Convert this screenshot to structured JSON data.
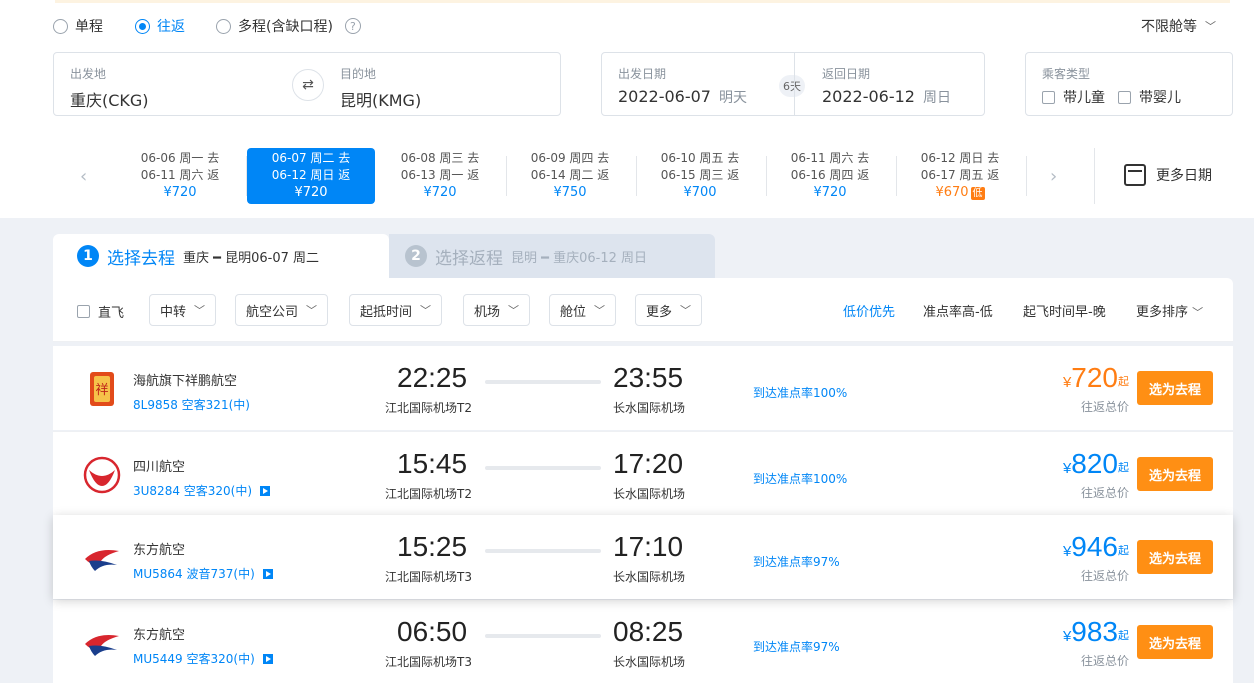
{
  "trip_types": [
    "单程",
    "往返",
    "多程(含缺口程)"
  ],
  "help_icon": "?",
  "cabin_select": "不限舱等",
  "search": {
    "from_label": "出发地",
    "from_value": "重庆(CKG)",
    "to_label": "目的地",
    "to_value": "昆明(KMG)",
    "depart_label": "出发日期",
    "depart_value": "2022-06-07",
    "depart_weekday": "明天",
    "return_label": "返回日期",
    "return_value": "2022-06-12",
    "return_weekday": "周日",
    "days": "6天",
    "pax_label": "乘客类型",
    "child": "带儿童",
    "infant": "带婴儿"
  },
  "date_options": [
    {
      "go": "06-06  周一 去",
      "back": "06-11  周六 返",
      "price": "¥720"
    },
    {
      "go": "06-07  周二 去",
      "back": "06-12  周日 返",
      "price": "¥720",
      "selected": true
    },
    {
      "go": "06-08  周三 去",
      "back": "06-13  周一 返",
      "price": "¥720"
    },
    {
      "go": "06-09  周四 去",
      "back": "06-14  周二 返",
      "price": "¥750"
    },
    {
      "go": "06-10  周五 去",
      "back": "06-15  周三 返",
      "price": "¥700"
    },
    {
      "go": "06-11  周六 去",
      "back": "06-16  周四 返",
      "price": "¥720"
    },
    {
      "go": "06-12  周日 去",
      "back": "06-17  周五 返",
      "price": "¥670",
      "low": "低"
    }
  ],
  "more_dates": "更多日期",
  "tabs": {
    "step1_num": "1",
    "step1_title": "选择去程",
    "step1_sub": "重庆 ━ 昆明06-07 周二",
    "step2_num": "2",
    "step2_title": "选择返程",
    "step2_sub": "昆明 ━ 重庆06-12 周日"
  },
  "filters": {
    "direct": "直飞",
    "items": [
      "中转",
      "航空公司",
      "起抵时间",
      "机场",
      "舱位",
      "更多"
    ]
  },
  "sorts": [
    "低价优先",
    "准点率高-低",
    "起飞时间早-晚",
    "更多排序"
  ],
  "flights": [
    {
      "airline": "海航旗下祥鹏航空",
      "flight": "8L9858 空客321(中)",
      "dep": "22:25",
      "dep_apt": "江北国际机场T2",
      "arr": "23:55",
      "arr_apt": "长水国际机场",
      "ontime": "到达准点率100%",
      "price": "720",
      "cur": "¥",
      "qi": "起",
      "total": "往返总价",
      "btn": "选为去程"
    },
    {
      "airline": "四川航空",
      "flight": "3U8284 空客320(中)",
      "dep": "15:45",
      "dep_apt": "江北国际机场T2",
      "arr": "17:20",
      "arr_apt": "长水国际机场",
      "ontime": "到达准点率100%",
      "price": "820",
      "cur": "¥",
      "qi": "起",
      "total": "往返总价",
      "btn": "选为去程"
    },
    {
      "airline": "东方航空",
      "flight": "MU5864 波音737(中)",
      "dep": "15:25",
      "dep_apt": "江北国际机场T3",
      "arr": "17:10",
      "arr_apt": "长水国际机场",
      "ontime": "到达准点率97%",
      "price": "946",
      "cur": "¥",
      "qi": "起",
      "total": "往返总价",
      "btn": "选为去程"
    },
    {
      "airline": "东方航空",
      "flight": "MU5449 空客320(中)",
      "dep": "06:50",
      "dep_apt": "江北国际机场T3",
      "arr": "08:25",
      "arr_apt": "长水国际机场",
      "ontime": "到达准点率97%",
      "price": "983",
      "cur": "¥",
      "qi": "起",
      "total": "往返总价",
      "btn": "选为去程"
    }
  ],
  "colors": {
    "accent": "#0086f6",
    "orange": "#ff7d13",
    "button": "#ff8f14"
  }
}
